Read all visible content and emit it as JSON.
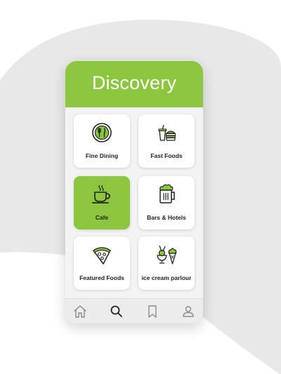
{
  "header": {
    "title": "Discovery"
  },
  "categories": [
    {
      "label": "Fine Dining",
      "icon": "fine-dining-icon",
      "active": false
    },
    {
      "label": "Fast Foods",
      "icon": "fast-food-icon",
      "active": false
    },
    {
      "label": "Cafe",
      "icon": "coffee-cup-icon",
      "active": true
    },
    {
      "label": "Bars & Hotels",
      "icon": "beer-mug-icon",
      "active": false
    },
    {
      "label": "Featured Foods",
      "icon": "pizza-slice-icon",
      "active": false
    },
    {
      "label": "ice cream parlour",
      "icon": "ice-cream-icon",
      "active": false
    }
  ],
  "nav": [
    {
      "icon": "home-icon"
    },
    {
      "icon": "search-icon"
    },
    {
      "icon": "bookmark-icon"
    },
    {
      "icon": "profile-icon"
    }
  ],
  "colors": {
    "accent": "#8cc63f",
    "background_shape": "#e8e8e8",
    "icon_outline": "#222222"
  }
}
